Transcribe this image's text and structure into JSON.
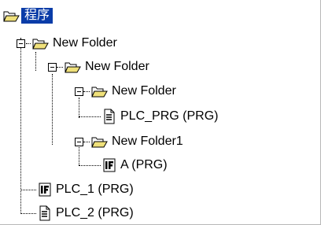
{
  "tree": {
    "root": {
      "label": "程序",
      "icon": "open-folder-icon"
    },
    "nodes": [
      {
        "label": "New Folder",
        "icon": "open-folder-icon",
        "expanded": true
      },
      {
        "label": "New Folder",
        "icon": "open-folder-icon",
        "expanded": true
      },
      {
        "label": "New Folder",
        "icon": "open-folder-icon",
        "expanded": true
      },
      {
        "label": "PLC_PRG (PRG)",
        "icon": "document-icon"
      },
      {
        "label": "New Folder1",
        "icon": "open-folder-icon",
        "expanded": true
      },
      {
        "label": "A (PRG)",
        "icon": "function-block-icon"
      },
      {
        "label": "PLC_1 (PRG)",
        "icon": "function-block-icon"
      },
      {
        "label": "PLC_2 (PRG)",
        "icon": "document-icon"
      }
    ]
  },
  "colors": {
    "selection": "#0a3ca8",
    "folder": "#efe07a",
    "folder_outline": "#000000"
  }
}
